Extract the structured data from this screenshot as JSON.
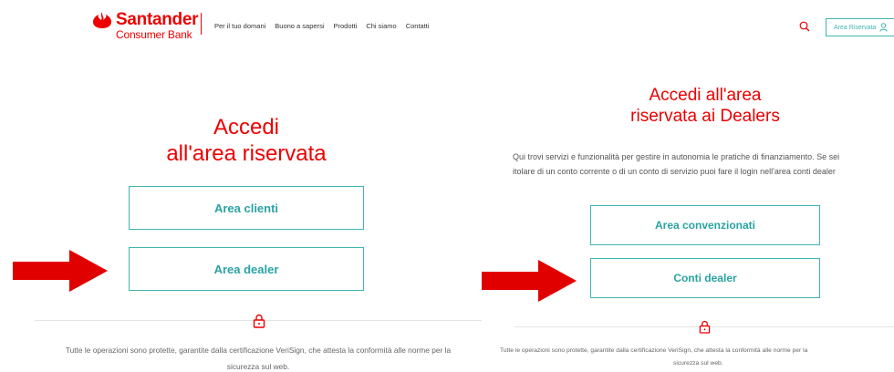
{
  "left": {
    "logo": {
      "brand": "Santander",
      "sub": "Consumer Bank"
    },
    "nav": [
      "Per il tuo domani",
      "Buono a sapersi",
      "Prodotti",
      "Chi siamo",
      "Contatti"
    ],
    "title_line1": "Accedi",
    "title_line2": "all'area riservata",
    "buttons": {
      "clienti": "Area clienti",
      "dealer": "Area dealer"
    },
    "footer_line1": "Tutte le operazioni sono protette, garantite dalla certificazione VeriSign, che attesta la conformità alle norme per la",
    "footer_line2": "sicurezza sul web."
  },
  "right": {
    "header_button": "Area Riservata",
    "title_line1": "Accedi all'area",
    "title_line2": "riservata ai Dealers",
    "desc_line1": "Qui trovi servizi e funzionalità per gestire in autonomia le pratiche di finanziamento. Se sei",
    "desc_line2": "itolare di un conto corrente o di un conto di servizio puoi fare il login nell'area conti dealer",
    "buttons": {
      "convenzionati": "Area convenzionati",
      "conti": "Conti dealer"
    },
    "footer_line1": "Tutte le operazioni sono protette, garantite dalla certificazione VeriSign, che attesta la conformità alle norme per la",
    "footer_line2": "sicurezza sul web."
  },
  "colors": {
    "brand_red": "#ec0000",
    "teal": "#3fb5b2",
    "arrow_red": "#e00000"
  },
  "icons": [
    "flame-logo-icon",
    "search-icon",
    "user-icon",
    "lock-icon",
    "arrow-icon"
  ]
}
